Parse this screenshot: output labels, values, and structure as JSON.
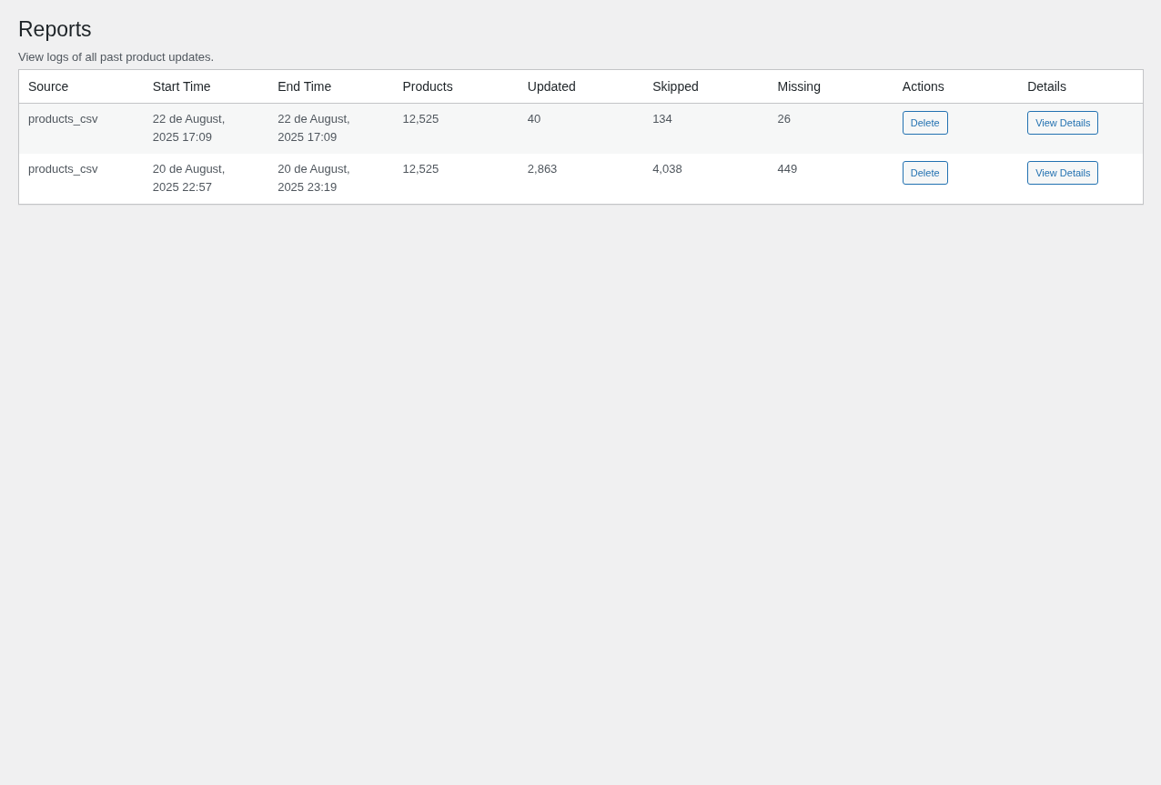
{
  "page": {
    "title": "Reports",
    "description": "View logs of all past product updates."
  },
  "table": {
    "columns": [
      "Source",
      "Start Time",
      "End Time",
      "Products",
      "Updated",
      "Skipped",
      "Missing",
      "Actions",
      "Details"
    ],
    "rows": [
      {
        "source": "products_csv",
        "start_time": "22 de August, 2025 17:09",
        "end_time": "22 de August, 2025 17:09",
        "products": "12,525",
        "updated": "40",
        "skipped": "134",
        "missing": "26",
        "action": "Delete",
        "details": "View Details"
      },
      {
        "source": "products_csv",
        "start_time": "20 de August, 2025 22:57",
        "end_time": "20 de August, 2025 23:19",
        "products": "12,525",
        "updated": "2,863",
        "skipped": "4,038",
        "missing": "449",
        "action": "Delete",
        "details": "View Details"
      }
    ]
  }
}
